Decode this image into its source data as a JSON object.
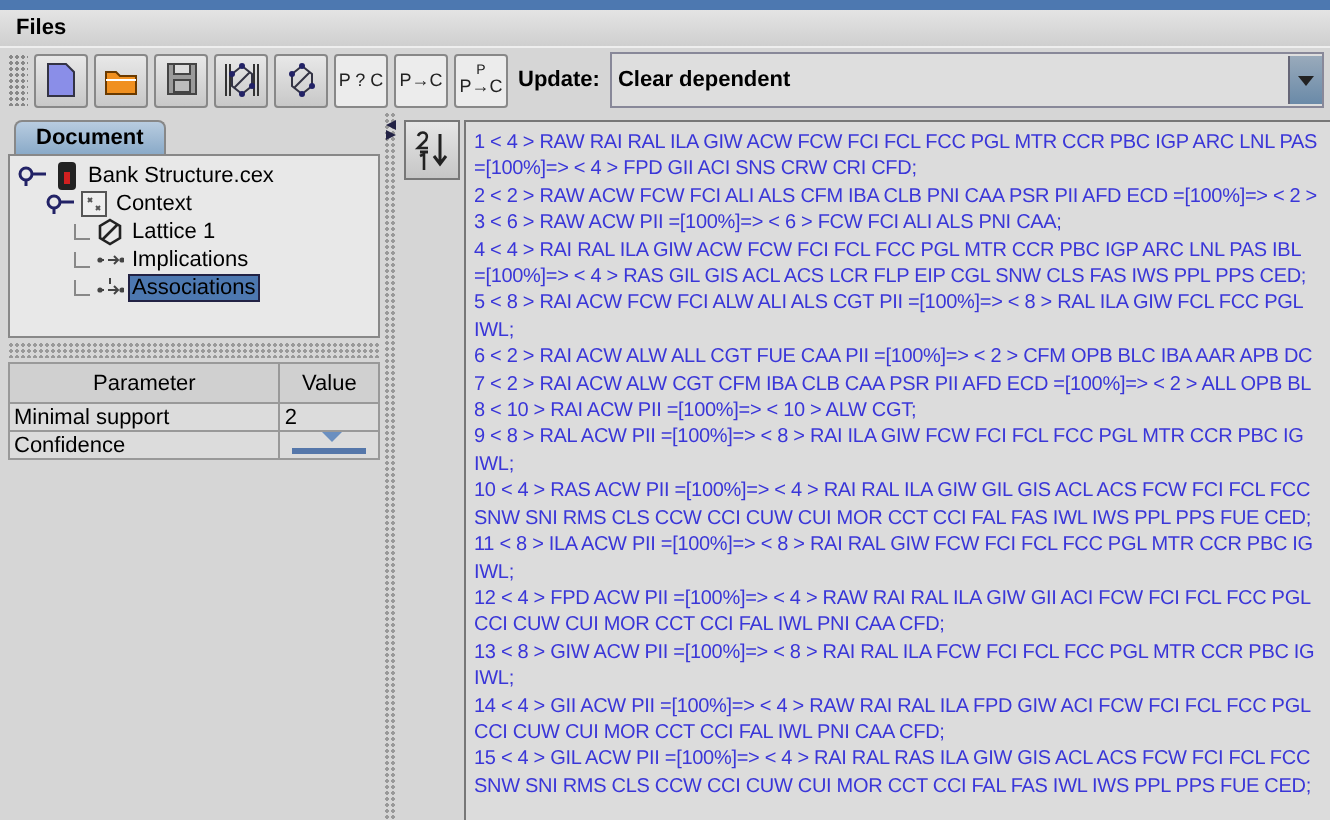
{
  "menu": [
    "Files"
  ],
  "toolbar": {
    "buttons": [
      {
        "kind": "new"
      },
      {
        "kind": "open"
      },
      {
        "kind": "save"
      },
      {
        "kind": "lattice-framed"
      },
      {
        "kind": "lattice"
      },
      {
        "kind": "text",
        "label": "P ? C"
      },
      {
        "kind": "text",
        "label": "P→C"
      },
      {
        "kind": "text",
        "label": "P→C",
        "over": "P"
      }
    ],
    "update_label": "Update:",
    "update_value": "Clear dependent"
  },
  "document_tab": {
    "label": "Document",
    "selected": true
  },
  "tree": [
    {
      "label": "Bank Structure.cex",
      "kind": "file",
      "expanded": true,
      "selected": false,
      "children": [
        {
          "label": "Context",
          "kind": "context",
          "expanded": true,
          "selected": false,
          "children": [
            {
              "label": "Lattice 1",
              "kind": "lattice",
              "selected": false
            },
            {
              "label": "Implications",
              "kind": "implications",
              "selected": false
            },
            {
              "label": "Associations",
              "kind": "associations",
              "selected": true
            }
          ]
        }
      ]
    }
  ],
  "parameters": {
    "columns": [
      "Parameter",
      "Value"
    ],
    "rows": [
      {
        "kind": "text",
        "name": "Minimal support",
        "value": "2"
      },
      {
        "kind": "slider",
        "name": "Confidence",
        "level": 0.54
      }
    ]
  },
  "rules": [
    "1 < 4 > RAW RAI RAL ILA GIW ACW FCW FCI FCL FCC PGL MTR CCR PBC IGP ARC LNL PAS",
    "=[100%]=> < 4 > FPD GII ACI SNS CRW CRI CFD;",
    "2 < 2 > RAW ACW FCW FCI ALI ALS CFM IBA CLB PNI CAA PSR PII AFD ECD =[100%]=> < 2 >",
    "3 < 6 > RAW ACW PII =[100%]=> < 6 > FCW FCI ALI ALS PNI CAA;",
    "4 < 4 > RAI RAL ILA GIW ACW FCW FCI FCL FCC PGL MTR CCR PBC IGP ARC LNL PAS IBL",
    "=[100%]=> < 4 > RAS GIL GIS ACL ACS LCR FLP EIP CGL SNW CLS FAS IWS PPL PPS CED;",
    "5 < 8 > RAI ACW FCW FCI ALW ALI ALS CGT PII =[100%]=> < 8 > RAL ILA GIW FCL FCC PGL",
    "IWL;",
    "6 < 2 > RAI ACW ALW ALL CGT FUE CAA PII =[100%]=> < 2 > CFM OPB BLC IBA AAR APB DC",
    "7 < 2 > RAI ACW ALW CGT CFM IBA CLB CAA PSR PII AFD ECD =[100%]=> < 2 > ALL OPB BL",
    "8 < 10 > RAI ACW PII =[100%]=> < 10 > ALW CGT;",
    "9 < 8 > RAL ACW PII =[100%]=> < 8 > RAI ILA GIW FCW FCI FCL FCC PGL MTR CCR PBC IG",
    "IWL;",
    "10 < 4 > RAS ACW PII =[100%]=> < 4 > RAI RAL ILA GIW GIL GIS ACL ACS FCW FCI FCL FCC",
    "SNW SNI RMS CLS CCW CCI CUW CUI MOR CCT CCI FAL FAS IWL IWS PPL PPS FUE CED;",
    "11 < 8 > ILA ACW PII =[100%]=> < 8 > RAI RAL GIW FCW FCI FCL FCC PGL MTR CCR PBC IG",
    "IWL;",
    "12 < 4 > FPD ACW PII =[100%]=> < 4 > RAW RAI RAL ILA GIW GII ACI FCW FCI FCL FCC PGL",
    "CCI CUW CUI MOR CCT CCI FAL IWL PNI CAA CFD;",
    "13 < 8 > GIW ACW PII =[100%]=> < 8 > RAI RAL ILA FCW FCI FCL FCC PGL MTR CCR PBC IG",
    "IWL;",
    "14 < 4 > GII ACW PII =[100%]=> < 4 > RAW RAI RAL ILA FPD GIW ACI FCW FCI FCL FCC PGL",
    "CCI CUW CUI MOR CCT CCI FAL IWL PNI CAA CFD;",
    "15 < 4 > GIL ACW PII =[100%]=> < 4 > RAI RAL RAS ILA GIW GIS ACL ACS FCW FCI FCL FCC",
    "SNW SNI RMS CLS CCW CCI CUW CUI MOR CCT CCI FAL FAS IWL IWS PPL PPS FUE CED;"
  ]
}
